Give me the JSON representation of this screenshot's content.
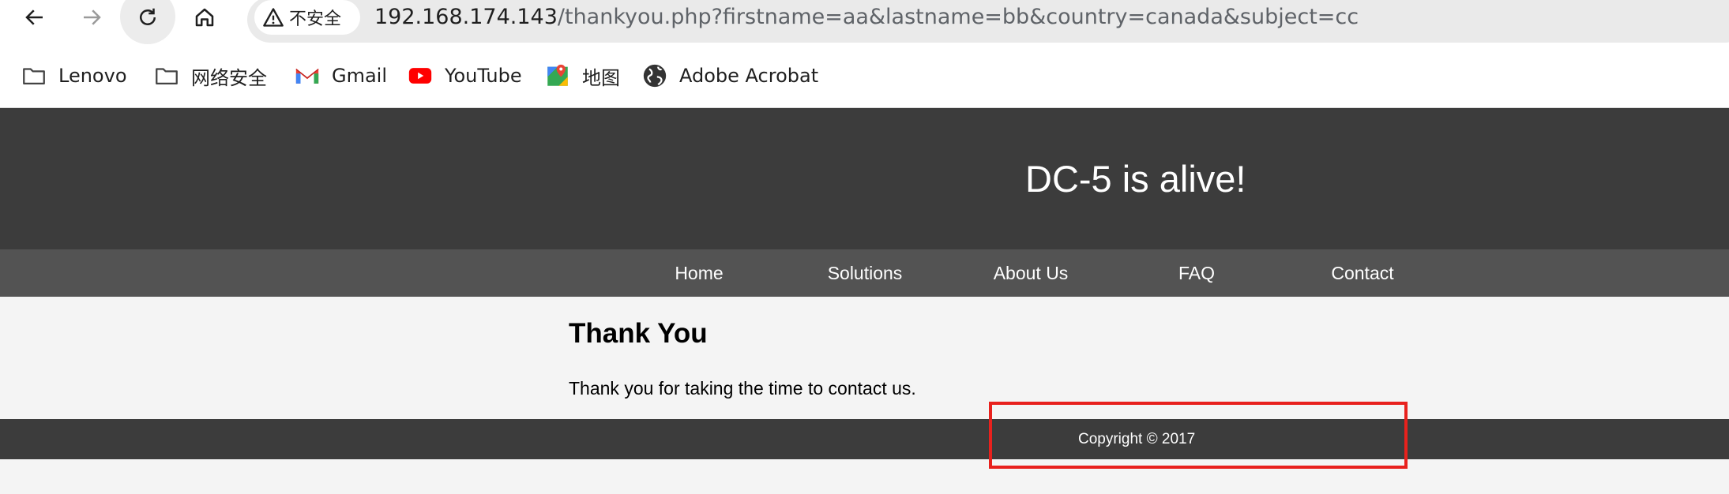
{
  "browser": {
    "security_label": "不安全",
    "url_host": "192.168.174.143",
    "url_path": "/thankyou.php?firstname=aa&lastname=bb&country=canada&subject=cc",
    "bookmarks": [
      {
        "label": "Lenovo",
        "icon": "folder-icon"
      },
      {
        "label": "网络安全",
        "icon": "folder-icon"
      },
      {
        "label": "Gmail",
        "icon": "gmail-icon"
      },
      {
        "label": "YouTube",
        "icon": "youtube-icon"
      },
      {
        "label": "地图",
        "icon": "maps-icon"
      },
      {
        "label": "Adobe Acrobat",
        "icon": "globe-icon"
      }
    ]
  },
  "site": {
    "title": "DC-5 is alive!",
    "nav": [
      "Home",
      "Solutions",
      "About Us",
      "FAQ",
      "Contact"
    ],
    "heading": "Thank You",
    "message": "Thank you for taking the time to contact us.",
    "footer": "Copyright © 2017"
  },
  "colors": {
    "header_bg": "#3c3c3c",
    "nav_bg": "#535353",
    "content_bg": "#f4f4f4",
    "annotation": "#e8211d"
  }
}
